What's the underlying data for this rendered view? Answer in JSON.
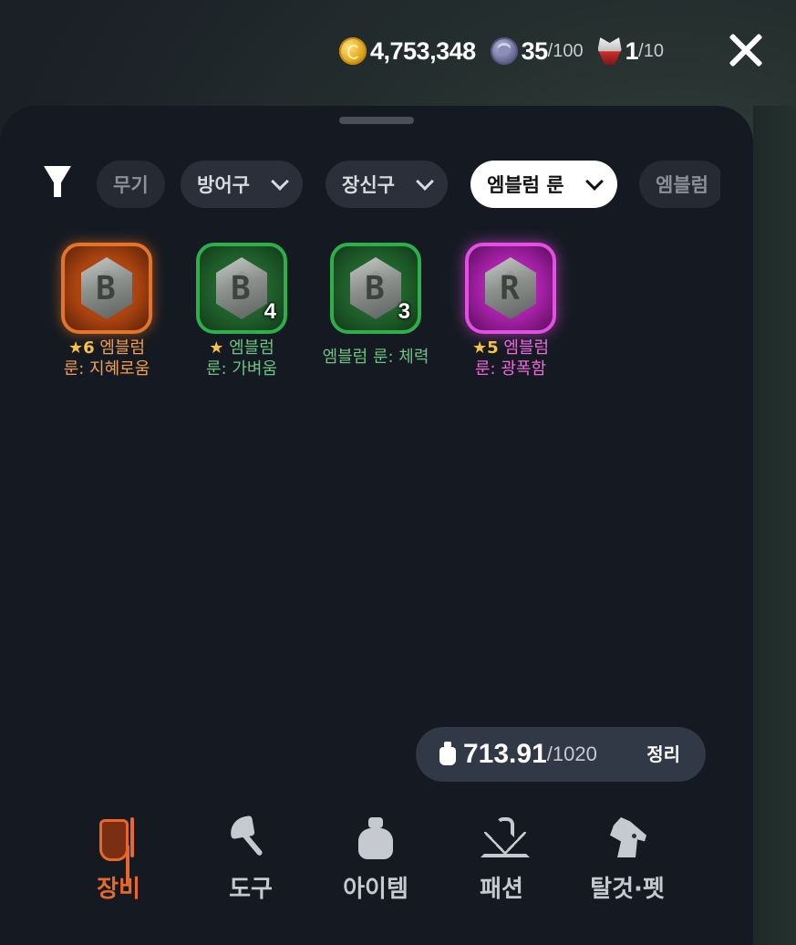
{
  "currencies": [
    {
      "id": "gold",
      "icon": "gold-coin-icon",
      "value": "4,753,348",
      "max": ""
    },
    {
      "id": "gem",
      "icon": "gem-coin-icon",
      "value": "35",
      "max": "/100"
    },
    {
      "id": "wolf",
      "icon": "wolf-token-icon",
      "value": "1",
      "max": "/10"
    }
  ],
  "filters": {
    "chips": [
      {
        "label": "무기",
        "state": "dim"
      },
      {
        "label": "방어구",
        "state": "normal",
        "dropdown": true
      },
      {
        "label": "장신구",
        "state": "normal",
        "dropdown": true
      },
      {
        "label": "엠블럼 룬",
        "state": "active",
        "dropdown": true
      },
      {
        "label": "엠블럼",
        "state": "dim"
      }
    ]
  },
  "items": [
    {
      "grade": "orange",
      "stars": "★6",
      "line1": "엠블럼",
      "line2": "룬: 지혜로움",
      "count": "",
      "glyph": "B"
    },
    {
      "grade": "green",
      "stars": "★",
      "line1": "엠블럼",
      "line2": "룬: 가벼움",
      "count": "4",
      "glyph": "B"
    },
    {
      "grade": "green",
      "stars": "",
      "line1": "엠블럼 룬: 체력",
      "line2": "",
      "count": "3",
      "glyph": "B"
    },
    {
      "grade": "pink",
      "stars": "★5",
      "line1": "엠블럼",
      "line2": "룬: 광폭함",
      "count": "",
      "glyph": "R"
    }
  ],
  "weight": {
    "value": "713.91",
    "max": "/1020",
    "sort_label": "정리"
  },
  "nav": [
    {
      "label": "장비",
      "icon": "shield-sword-icon",
      "active": true
    },
    {
      "label": "도구",
      "icon": "axe-icon",
      "active": false
    },
    {
      "label": "아이템",
      "icon": "bag-icon",
      "active": false
    },
    {
      "label": "패션",
      "icon": "hanger-icon",
      "active": false
    },
    {
      "label": "탈것·펫",
      "icon": "horse-icon",
      "active": false
    }
  ],
  "colors": {
    "accent": "#e8672b",
    "orange": "#f2a04f",
    "green": "#6fc383",
    "pink": "#ee6bd9",
    "star": "#f6c445"
  }
}
